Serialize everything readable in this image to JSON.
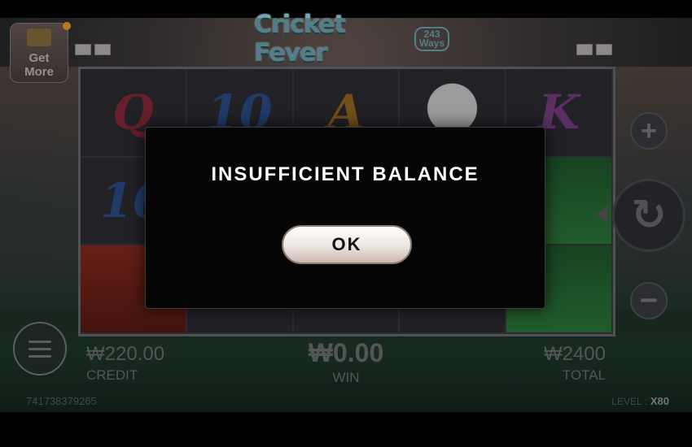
{
  "game": {
    "logo_title": "Cricket Fever",
    "logo_ways_number": "243",
    "logo_ways_label": "Ways",
    "get_more_label": "Get More"
  },
  "reels": [
    [
      "Q",
      "10",
      "A",
      "cricket-ball",
      "K"
    ],
    [
      "10",
      "",
      "",
      "",
      "player-green"
    ],
    [
      "player-red",
      "",
      "",
      "",
      "player-green"
    ]
  ],
  "controls": {
    "plus_symbol": "+",
    "minus_symbol": "−",
    "spin_symbol": "↻"
  },
  "footer": {
    "credit_value": "₩220.00",
    "credit_label": "CREDIT",
    "win_value": "₩0.00",
    "win_label": "WIN",
    "total_value": "₩2400",
    "total_label": "TOTAL",
    "session_id": "741738379265",
    "level_label": "LEVEL :",
    "level_value": "X80"
  },
  "dialog": {
    "message": "INSUFFICIENT BALANCE",
    "ok_label": "OK"
  }
}
